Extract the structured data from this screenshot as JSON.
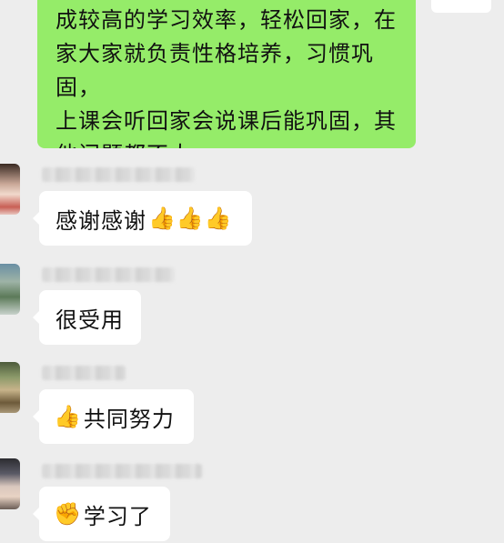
{
  "chat": {
    "outgoing": {
      "text": "成较高的学习效率，轻松回家，在\n家大家就负责性格培养，习惯巩固，\n上课会听回家会说课后能巩固，其\n他问题都不大"
    },
    "messages": [
      {
        "text": "感谢感谢",
        "emoji": "👍👍👍"
      },
      {
        "text": "很受用"
      },
      {
        "emoji": "👍",
        "text": "共同努力"
      },
      {
        "emoji": "✊",
        "text": "学习了"
      }
    ]
  },
  "colors": {
    "background": "#ededed",
    "outgoing_bubble": "#95ec69",
    "incoming_bubble": "#ffffff"
  },
  "icons": {
    "thumbs_up": "thumbs-up-icon",
    "fist": "fist-icon"
  }
}
